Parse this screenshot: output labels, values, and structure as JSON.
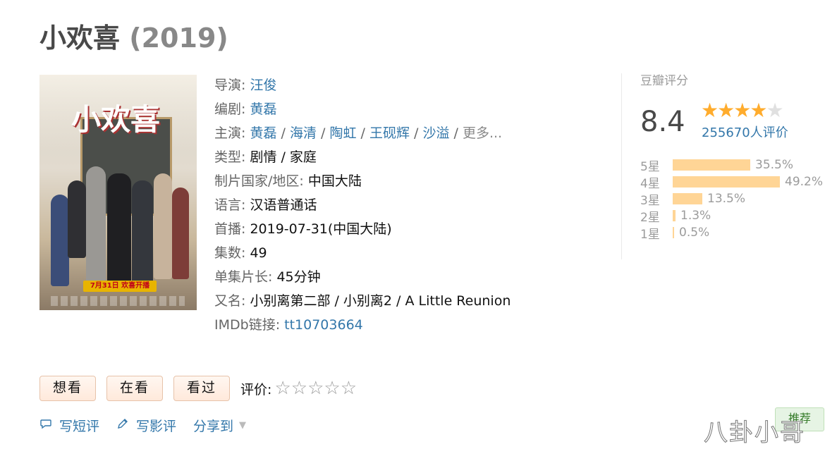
{
  "title": {
    "name": "小欢喜",
    "year": "(2019)"
  },
  "poster": {
    "logo_text": "小欢喜",
    "badge": "7月31日 欢喜开播"
  },
  "info": {
    "director_label": "导演:",
    "director": "汪俊",
    "writer_label": "编剧:",
    "writer": "黄磊",
    "cast_label": "主演:",
    "cast": [
      "黄磊",
      "海清",
      "陶虹",
      "王砚辉",
      "沙溢"
    ],
    "cast_more": "更多...",
    "genre_label": "类型:",
    "genre": "剧情 / 家庭",
    "country_label": "制片国家/地区:",
    "country": "中国大陆",
    "language_label": "语言:",
    "language": "汉语普通话",
    "premiere_label": "首播:",
    "premiere": "2019-07-31(中国大陆)",
    "episodes_label": "集数:",
    "episodes": "49",
    "runtime_label": "单集片长:",
    "runtime": "45分钟",
    "aka_label": "又名:",
    "aka": "小别离第二部 / 小别离2 / A Little Reunion",
    "imdb_label": "IMDb链接:",
    "imdb": "tt10703664"
  },
  "rating": {
    "label": "豆瓣评分",
    "score": "8.4",
    "stars": 4,
    "votes": "255670人评价",
    "distribution": [
      {
        "label": "5星",
        "percent": 35.5,
        "text": "35.5%"
      },
      {
        "label": "4星",
        "percent": 49.2,
        "text": "49.2%"
      },
      {
        "label": "3星",
        "percent": 13.5,
        "text": "13.5%"
      },
      {
        "label": "2星",
        "percent": 1.3,
        "text": "1.3%"
      },
      {
        "label": "1星",
        "percent": 0.5,
        "text": "0.5%"
      }
    ]
  },
  "actions": {
    "want": "想看",
    "watching": "在看",
    "watched": "看过",
    "rate_label": "评价:",
    "rate_stars": "☆☆☆☆☆"
  },
  "links": {
    "short_review": "写短评",
    "review": "写影评",
    "share": "分享到"
  },
  "recommend": "推荐",
  "watermark": "八卦小哥",
  "colors": {
    "link": "#3377aa",
    "star": "#ffac2d",
    "bar": "#ffd596"
  }
}
